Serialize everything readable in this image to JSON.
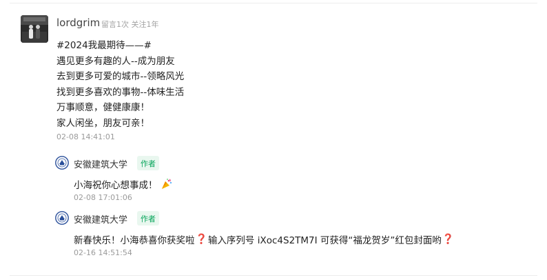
{
  "comment": {
    "username": "lordgrim",
    "meta": "留言1次 关注1年",
    "lines": [
      "#2024我最期待——#",
      "遇见更多有趣的人--成为朋友",
      "去到更多可爱的城市--领略风光",
      "找到更多喜欢的事物--体味生活",
      "万事顺意，健健康康！",
      "家人闲坐，朋友可亲！"
    ],
    "timestamp": "02-08 14:41:01",
    "avatar_icon": "user-photo-avatar"
  },
  "replies": [
    {
      "author": "安徽建筑大学",
      "badge": "作者",
      "logo_icon": "university-seal-icon",
      "text": "小海祝你心想事成！",
      "emoji_icon": "party-popper-emoji",
      "timestamp": "02-08 17:01:06"
    },
    {
      "author": "安徽建筑大学",
      "badge": "作者",
      "logo_icon": "university-seal-icon",
      "text_parts": [
        "新春快乐！小海恭喜你获奖啦",
        "❓",
        "输入序列号 iXoc4S2TM7I 可获得“福龙贺岁”红包封面哟",
        "❓"
      ],
      "timestamp": "02-16 14:51:54"
    }
  ],
  "colors": {
    "badge_text": "#07a55b",
    "badge_bg": "#e9f7ef",
    "question_mark": "#e0282e",
    "meta_gray": "#a3a3a3"
  }
}
